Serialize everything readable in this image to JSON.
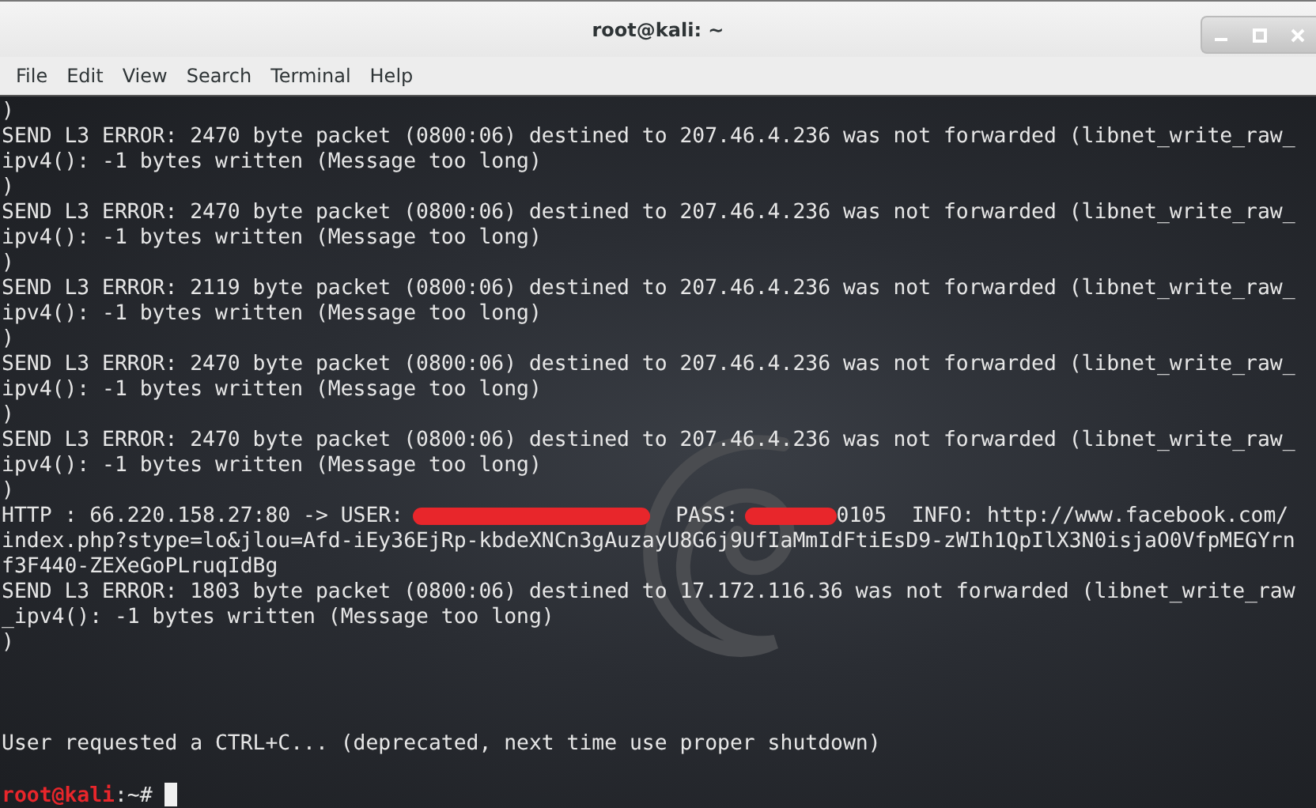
{
  "window": {
    "title": "root@kali: ~"
  },
  "menu": [
    {
      "label": "File"
    },
    {
      "label": "Edit"
    },
    {
      "label": "View"
    },
    {
      "label": "Search"
    },
    {
      "label": "Terminal"
    },
    {
      "label": "Help"
    }
  ],
  "terminal": {
    "lines": [
      {
        "kind": "text",
        "text": ")"
      },
      {
        "kind": "text",
        "text": "SEND L3 ERROR: 2470 byte packet (0800:06) destined to 207.46.4.236 was not forwarded (libnet_write_raw_"
      },
      {
        "kind": "text",
        "text": "ipv4(): -1 bytes written (Message too long)"
      },
      {
        "kind": "text",
        "text": ")"
      },
      {
        "kind": "text",
        "text": "SEND L3 ERROR: 2470 byte packet (0800:06) destined to 207.46.4.236 was not forwarded (libnet_write_raw_"
      },
      {
        "kind": "text",
        "text": "ipv4(): -1 bytes written (Message too long)"
      },
      {
        "kind": "text",
        "text": ")"
      },
      {
        "kind": "text",
        "text": "SEND L3 ERROR: 2119 byte packet (0800:06) destined to 207.46.4.236 was not forwarded (libnet_write_raw_"
      },
      {
        "kind": "text",
        "text": "ipv4(): -1 bytes written (Message too long)"
      },
      {
        "kind": "text",
        "text": ")"
      },
      {
        "kind": "text",
        "text": "SEND L3 ERROR: 2470 byte packet (0800:06) destined to 207.46.4.236 was not forwarded (libnet_write_raw_"
      },
      {
        "kind": "text",
        "text": "ipv4(): -1 bytes written (Message too long)"
      },
      {
        "kind": "text",
        "text": ")"
      },
      {
        "kind": "text",
        "text": "SEND L3 ERROR: 2470 byte packet (0800:06) destined to 207.46.4.236 was not forwarded (libnet_write_raw_"
      },
      {
        "kind": "text",
        "text": "ipv4(): -1 bytes written (Message too long)"
      },
      {
        "kind": "text",
        "text": ")"
      },
      {
        "kind": "segments",
        "segments": [
          {
            "kind": "text",
            "text": "HTTP : 66.220.158.27:80 -> USER:"
          },
          {
            "kind": "redacted_long"
          },
          {
            "kind": "text",
            "text": "PASS:"
          },
          {
            "kind": "redacted_short"
          },
          {
            "kind": "text",
            "text": "0105  INFO: http://www.facebook.com/"
          }
        ]
      },
      {
        "kind": "text",
        "text": "index.php?stype=lo&jlou=Afd-iEy36EjRp-kbdeXNCn3gAuzayU8G6j9UfIaMmIdFtiEsD9-zWIh1QpIlX3N0isjaO0VfpMEGYrn"
      },
      {
        "kind": "text",
        "text": "f3F440-ZEXeGoPLruqIdBg"
      },
      {
        "kind": "text",
        "text": "SEND L3 ERROR: 1803 byte packet (0800:06) destined to 17.172.116.36 was not forwarded (libnet_write_raw"
      },
      {
        "kind": "text",
        "text": "_ipv4(): -1 bytes written (Message too long)"
      },
      {
        "kind": "text",
        "text": ")"
      },
      {
        "kind": "blank"
      },
      {
        "kind": "blank"
      },
      {
        "kind": "blank"
      },
      {
        "kind": "text",
        "text": "User requested a CTRL+C... (deprecated, next time use proper shutdown)"
      },
      {
        "kind": "blank"
      },
      {
        "kind": "prompt",
        "user_host": "root@kali",
        "suffix": ":~#"
      }
    ]
  }
}
